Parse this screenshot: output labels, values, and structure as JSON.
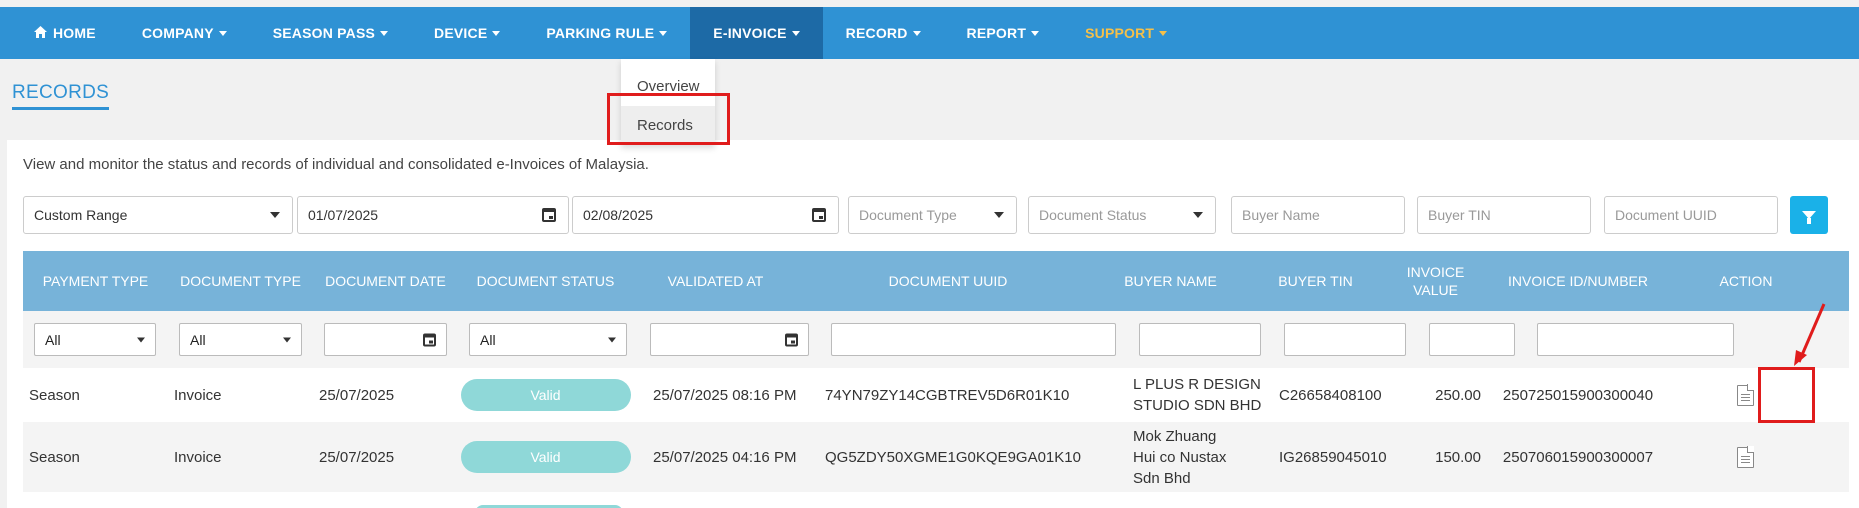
{
  "nav": {
    "items": [
      {
        "label": "HOME",
        "icon": "home-icon"
      },
      {
        "label": "COMPANY"
      },
      {
        "label": "SEASON PASS"
      },
      {
        "label": "DEVICE"
      },
      {
        "label": "PARKING RULE"
      },
      {
        "label": "E-INVOICE",
        "active": true
      },
      {
        "label": "RECORD"
      },
      {
        "label": "REPORT"
      },
      {
        "label": "SUPPORT"
      }
    ],
    "dropdown": [
      "Overview",
      "Records"
    ]
  },
  "page": {
    "title": "RECORDS",
    "description": "View and monitor the status and records of individual and consolidated e-Invoices of Malaysia."
  },
  "filters": {
    "range": "Custom Range",
    "date_from": "01/07/2025",
    "date_to": "02/08/2025",
    "document_type_placeholder": "Document Type",
    "document_status_placeholder": "Document Status",
    "buyer_name_placeholder": "Buyer Name",
    "buyer_tin_placeholder": "Buyer TIN",
    "document_uuid_placeholder": "Document UUID"
  },
  "table": {
    "headers": [
      "PAYMENT TYPE",
      "DOCUMENT TYPE",
      "DOCUMENT DATE",
      "DOCUMENT STATUS",
      "VALIDATED AT",
      "DOCUMENT UUID",
      "BUYER NAME",
      "BUYER TIN",
      "INVOICE VALUE",
      "INVOICE ID/NUMBER",
      "ACTION"
    ],
    "column_filters": {
      "payment_type": "All",
      "document_type": "All",
      "document_status": "All"
    },
    "rows": [
      {
        "payment_type": "Season",
        "document_type": "Invoice",
        "document_date": "25/07/2025",
        "status": "Valid",
        "validated_at": "25/07/2025 08:16 PM",
        "uuid": "74YN79ZY14CGBTREV5D6R01K10",
        "buyer_name": "L PLUS R DESIGN STUDIO SDN BHD",
        "buyer_tin": "C26658408100",
        "invoice_value": "250.00",
        "invoice_id": "250725015900300040"
      },
      {
        "payment_type": "Season",
        "document_type": "Invoice",
        "document_date": "25/07/2025",
        "status": "Valid",
        "validated_at": "25/07/2025 04:16 PM",
        "uuid": "QG5ZDY50XGME1G0KQE9GA01K10",
        "buyer_name": "Mok Zhuang Hui co Nustax Sdn Bhd",
        "buyer_tin": "IG26859045010",
        "invoice_value": "150.00",
        "invoice_id": "250706015900300007"
      }
    ]
  },
  "colors": {
    "navbar": "#2f92d4",
    "navbar_active": "#1d6aa6",
    "support": "#f5c04a",
    "table_header": "#77b3d9",
    "valid_badge": "#8fd8d8",
    "filter_button": "#1ab1e8",
    "annotation": "#e01c1c"
  }
}
